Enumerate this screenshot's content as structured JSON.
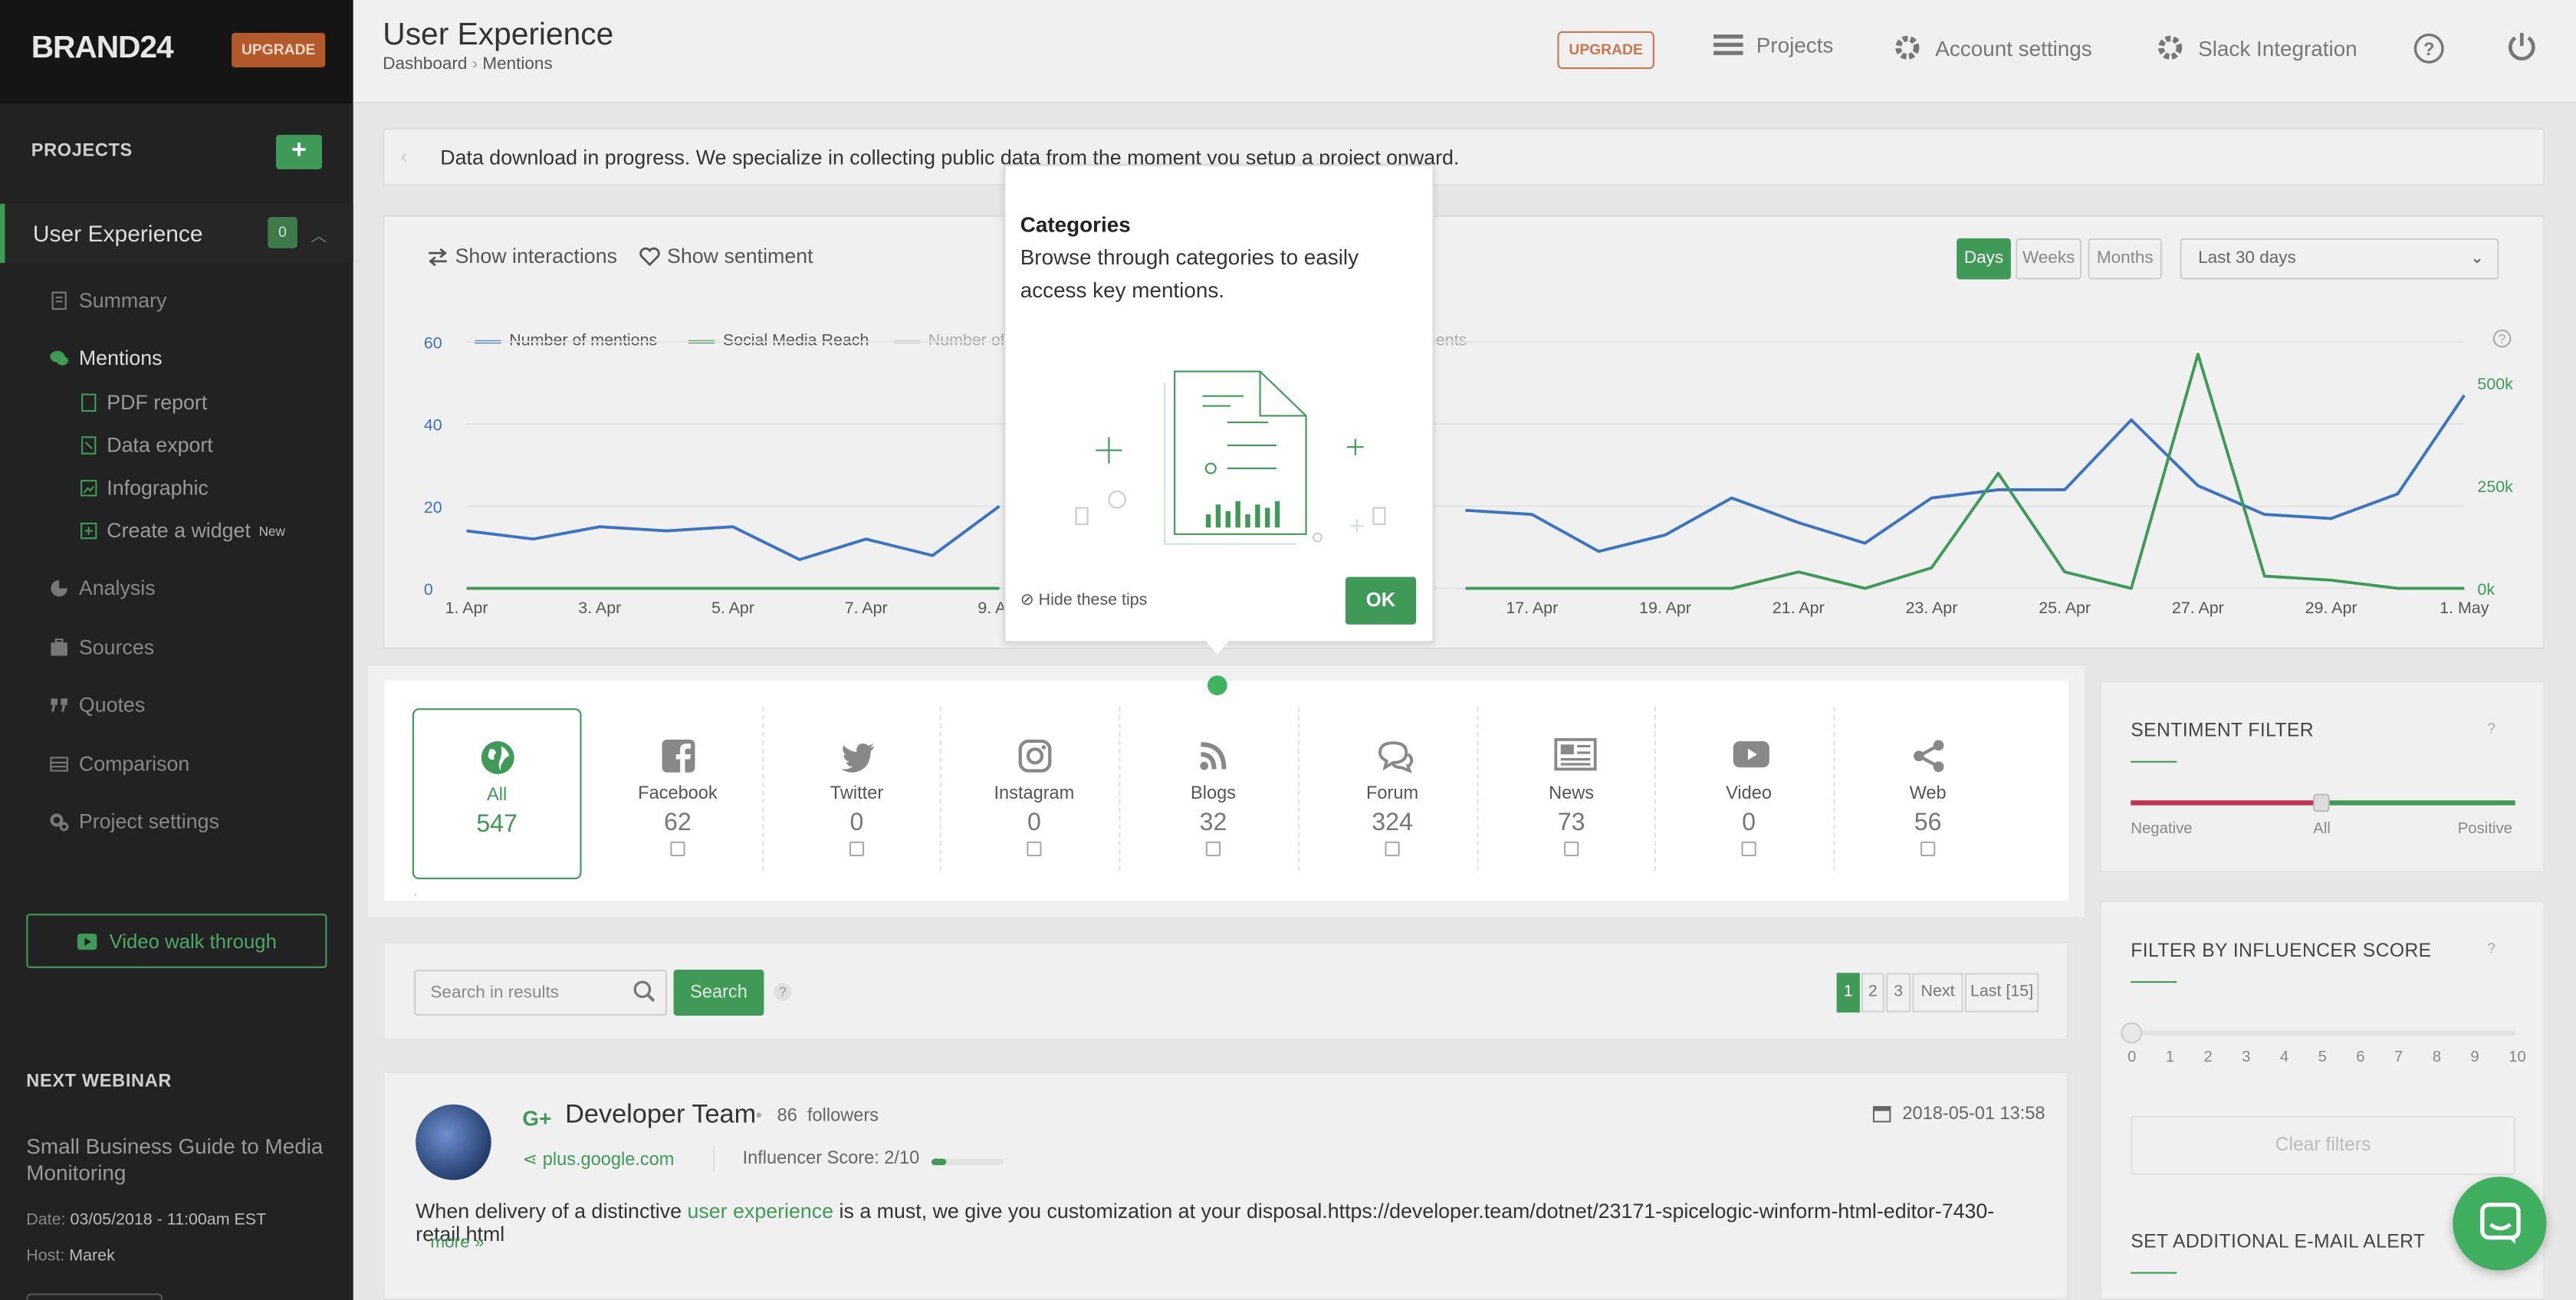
{
  "brand": "BRAND24",
  "sidebar": {
    "upgrade": "UPGRADE",
    "projects_heading": "PROJECTS",
    "add_label": "+",
    "project": {
      "name": "User Experience",
      "badge": "0"
    },
    "nav": [
      {
        "label": "Summary",
        "icon": "summary-icon"
      },
      {
        "label": "Mentions",
        "icon": "mentions-icon"
      },
      {
        "label": "Analysis",
        "icon": "analysis-icon"
      },
      {
        "label": "Sources",
        "icon": "sources-icon"
      },
      {
        "label": "Quotes",
        "icon": "quotes-icon"
      },
      {
        "label": "Comparison",
        "icon": "comparison-icon"
      },
      {
        "label": "Project settings",
        "icon": "settings-icon"
      }
    ],
    "subnav": [
      {
        "label": "PDF report"
      },
      {
        "label": "Data export"
      },
      {
        "label": "Infographic"
      },
      {
        "label": "Create a widget",
        "tag": "New"
      }
    ],
    "video_walkthrough": "Video walk through",
    "webinar": {
      "heading": "NEXT WEBINAR",
      "title": "Small Business Guide to Media Monitoring",
      "date_label": "Date:",
      "date": "03/05/2018 - 11:00am EST",
      "host_label": "Host:",
      "host": "Marek"
    }
  },
  "header": {
    "title": "User Experience",
    "breadcrumb": [
      "Dashboard",
      "Mentions"
    ],
    "upgrade": "UPGRADE",
    "nav": [
      "Projects",
      "Account settings",
      "Slack Integration"
    ]
  },
  "banner": {
    "text": "Data download in progress. We specialize in collecting public data from the moment you setup a project onward."
  },
  "toolbar": {
    "show_interactions": "Show interactions",
    "show_sentiment": "Show sentiment",
    "ranges": [
      "Days",
      "Weeks",
      "Months"
    ],
    "active_range": "Days",
    "period": "Last 30 days"
  },
  "chart_data": {
    "type": "line",
    "x": [
      "1. Apr",
      "2. Apr",
      "3. Apr",
      "4. Apr",
      "5. Apr",
      "6. Apr",
      "7. Apr",
      "8. Apr",
      "9. Apr",
      "10. Apr",
      "11. Apr",
      "12. Apr",
      "13. Apr",
      "14. Apr",
      "15. Apr",
      "16. Apr",
      "17. Apr",
      "18. Apr",
      "19. Apr",
      "20. Apr",
      "21. Apr",
      "22. Apr",
      "23. Apr",
      "24. Apr",
      "25. Apr",
      "26. Apr",
      "27. Apr",
      "28. Apr",
      "29. Apr",
      "30. Apr",
      "1. May"
    ],
    "x_tick_labels": [
      "1. Apr",
      "3. Apr",
      "5. Apr",
      "7. Apr",
      "9. Apr",
      "17. Apr",
      "19. Apr",
      "21. Apr",
      "23. Apr",
      "25. Apr",
      "27. Apr",
      "29. Apr",
      "1. May"
    ],
    "y_left_ticks": [
      "0",
      "20",
      "40",
      "60"
    ],
    "y_right_ticks": [
      "0k",
      "250k",
      "500k"
    ],
    "ylim": [
      0,
      60
    ],
    "y2lim": [
      0,
      600000
    ],
    "legend": [
      "Number of mentions",
      "Social Media Reach",
      "Number of",
      "ents"
    ],
    "series": [
      {
        "name": "Number of mentions",
        "color": "#3a73c4",
        "axis": "left",
        "values": [
          14,
          12,
          15,
          14,
          15,
          7,
          12,
          8,
          20,
          null,
          null,
          null,
          null,
          null,
          null,
          19,
          18,
          9,
          13,
          22,
          16,
          11,
          22,
          24,
          24,
          41,
          25,
          18,
          17,
          23,
          47
        ]
      },
      {
        "name": "Social Media Reach",
        "color": "#3f9a57",
        "axis": "right",
        "values": [
          0,
          0,
          0,
          0,
          0,
          0,
          0,
          0,
          0,
          null,
          null,
          null,
          null,
          null,
          null,
          0,
          0,
          0,
          0,
          0,
          40000,
          0,
          50000,
          280000,
          40000,
          0,
          570000,
          30000,
          20000,
          0,
          0
        ]
      }
    ]
  },
  "categories": [
    {
      "label": "All",
      "value": "547",
      "icon": "globe-icon"
    },
    {
      "label": "Facebook",
      "value": "62",
      "icon": "facebook-icon"
    },
    {
      "label": "Twitter",
      "value": "0",
      "icon": "twitter-icon"
    },
    {
      "label": "Instagram",
      "value": "0",
      "icon": "instagram-icon"
    },
    {
      "label": "Blogs",
      "value": "32",
      "icon": "rss-icon"
    },
    {
      "label": "Forum",
      "value": "324",
      "icon": "forum-icon"
    },
    {
      "label": "News",
      "value": "73",
      "icon": "news-icon"
    },
    {
      "label": "Video",
      "value": "0",
      "icon": "youtube-icon"
    },
    {
      "label": "Web",
      "value": "56",
      "icon": "share-icon"
    }
  ],
  "search": {
    "placeholder": "Search in results",
    "button": "Search",
    "help": "?"
  },
  "pagination": [
    "1",
    "2",
    "3",
    "Next",
    "Last [15]"
  ],
  "mention": {
    "author": "Developer Team",
    "followers_count": "86",
    "followers_label": "followers",
    "source": "plus.google.com",
    "influencer_score": "Influencer Score: 2/10",
    "influencer_fraction": 0.2,
    "date": "2018-05-01 13:58",
    "text_before": "When delivery of a distinctive ",
    "highlight": "user experience",
    "text_after": " is a must, we give you customization at your disposal.https://developer.team/dotnet/23171-spicelogic-winform-html-editor-7430-retail.html",
    "more": "more »"
  },
  "sentiment_filter": {
    "heading": "SENTIMENT FILTER",
    "help": "?",
    "labels": [
      "Negative",
      "All",
      "Positive"
    ]
  },
  "influencer_filter": {
    "heading": "FILTER BY INFLUENCER SCORE",
    "help": "?",
    "scale": [
      "0",
      "1",
      "2",
      "3",
      "4",
      "5",
      "6",
      "7",
      "8",
      "9",
      "10"
    ],
    "clear": "Clear filters"
  },
  "email_alert": {
    "heading": "SET ADDITIONAL E-MAIL ALERT"
  },
  "popup": {
    "title": "Categories",
    "body": "Browse through categories to easily access key mentions.",
    "hide": "Hide these tips",
    "ok": "OK"
  },
  "colors": {
    "accent": "#3f9a57",
    "upgrade": "#b35a2a",
    "mentions_line": "#3a73c4"
  }
}
